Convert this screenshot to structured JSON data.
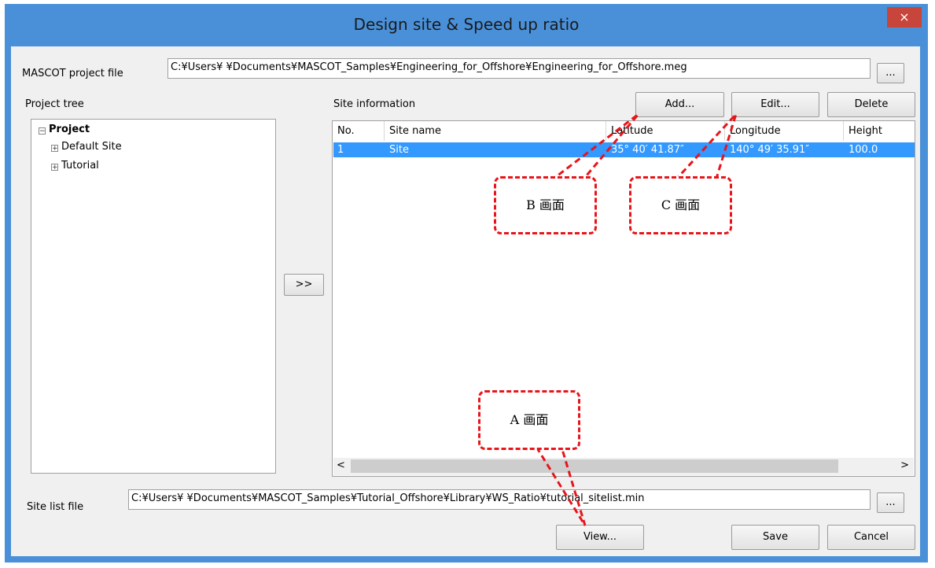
{
  "window": {
    "title": "Design site & Speed up ratio",
    "close_glyph": "×"
  },
  "project_file": {
    "label": "MASCOT project file",
    "value": "C:¥Users¥        ¥Documents¥MASCOT_Samples¥Engineering_for_Offshore¥Engineering_for_Offshore.meg",
    "browse_label": "..."
  },
  "project_tree": {
    "label": "Project tree",
    "root": "Project",
    "root_toggle": "−",
    "children": [
      {
        "label": "Default Site",
        "toggle": "+"
      },
      {
        "label": "Tutorial",
        "toggle": "+"
      }
    ]
  },
  "transfer_button": ">>",
  "site_info": {
    "label": "Site information",
    "add_label": "Add...",
    "edit_label": "Edit...",
    "delete_label": "Delete",
    "columns": [
      "No.",
      "Site name",
      "Latitude",
      "Longitude",
      "Height"
    ],
    "rows": [
      {
        "no": "1",
        "name": "Site",
        "latitude": "35° 40′ 41.87″",
        "longitude": "140° 49′ 35.91″",
        "height": "100.0"
      }
    ],
    "scroll_left": "<",
    "scroll_right": ">"
  },
  "site_list_file": {
    "label": "Site list file",
    "value": "C:¥Users¥        ¥Documents¥MASCOT_Samples¥Tutorial_Offshore¥Library¥WS_Ratio¥tutorial_sitelist.min",
    "browse_label": "..."
  },
  "footer": {
    "view_label": "View...",
    "save_label": "Save",
    "cancel_label": "Cancel"
  },
  "annotations": {
    "callout_a": "A 画面",
    "callout_b": "B 画面",
    "callout_c": "C 画面",
    "color": "#e8141a"
  },
  "colors": {
    "titlebar": "#4a90d8",
    "close": "#c7453b",
    "selection": "#3399ff",
    "dialog": "#f0f0f0"
  }
}
